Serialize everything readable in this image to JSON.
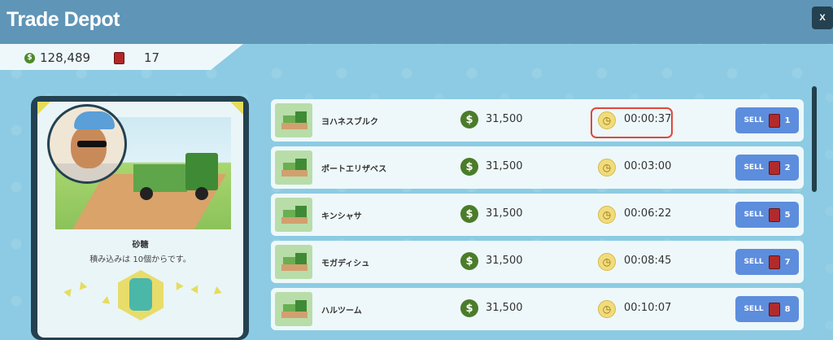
{
  "header": {
    "title": "Trade Depot",
    "close_label": "X"
  },
  "resources": {
    "coins": "128,489",
    "fuel": "17",
    "coin_symbol": "$"
  },
  "goods": {
    "name": "砂糖",
    "note": "積み込みは 10個からです。"
  },
  "routes": [
    {
      "city": "ヨハネスブルク",
      "price": "31,500",
      "time": "00:00:37",
      "sell_label": "SELL",
      "qty": "1",
      "highlighted": true
    },
    {
      "city": "ポートエリザベス",
      "price": "31,500",
      "time": "00:03:00",
      "sell_label": "SELL",
      "qty": "2",
      "highlighted": false
    },
    {
      "city": "キンシャサ",
      "price": "31,500",
      "time": "00:06:22",
      "sell_label": "SELL",
      "qty": "5",
      "highlighted": false
    },
    {
      "city": "モガディシュ",
      "price": "31,500",
      "time": "00:08:45",
      "sell_label": "SELL",
      "qty": "7",
      "highlighted": false
    },
    {
      "city": "ハルツーム",
      "price": "31,500",
      "time": "00:10:07",
      "sell_label": "SELL",
      "qty": "8",
      "highlighted": false
    }
  ],
  "icons": {
    "coin": "dollar-coin-icon",
    "fuel": "fuel-can-icon",
    "clock": "clock-icon",
    "truck": "truck-icon"
  },
  "colors": {
    "header": "#5f95b7",
    "sell_button": "#5d8ddd",
    "highlight": "#e0483b",
    "coin": "#4b7c2a"
  }
}
